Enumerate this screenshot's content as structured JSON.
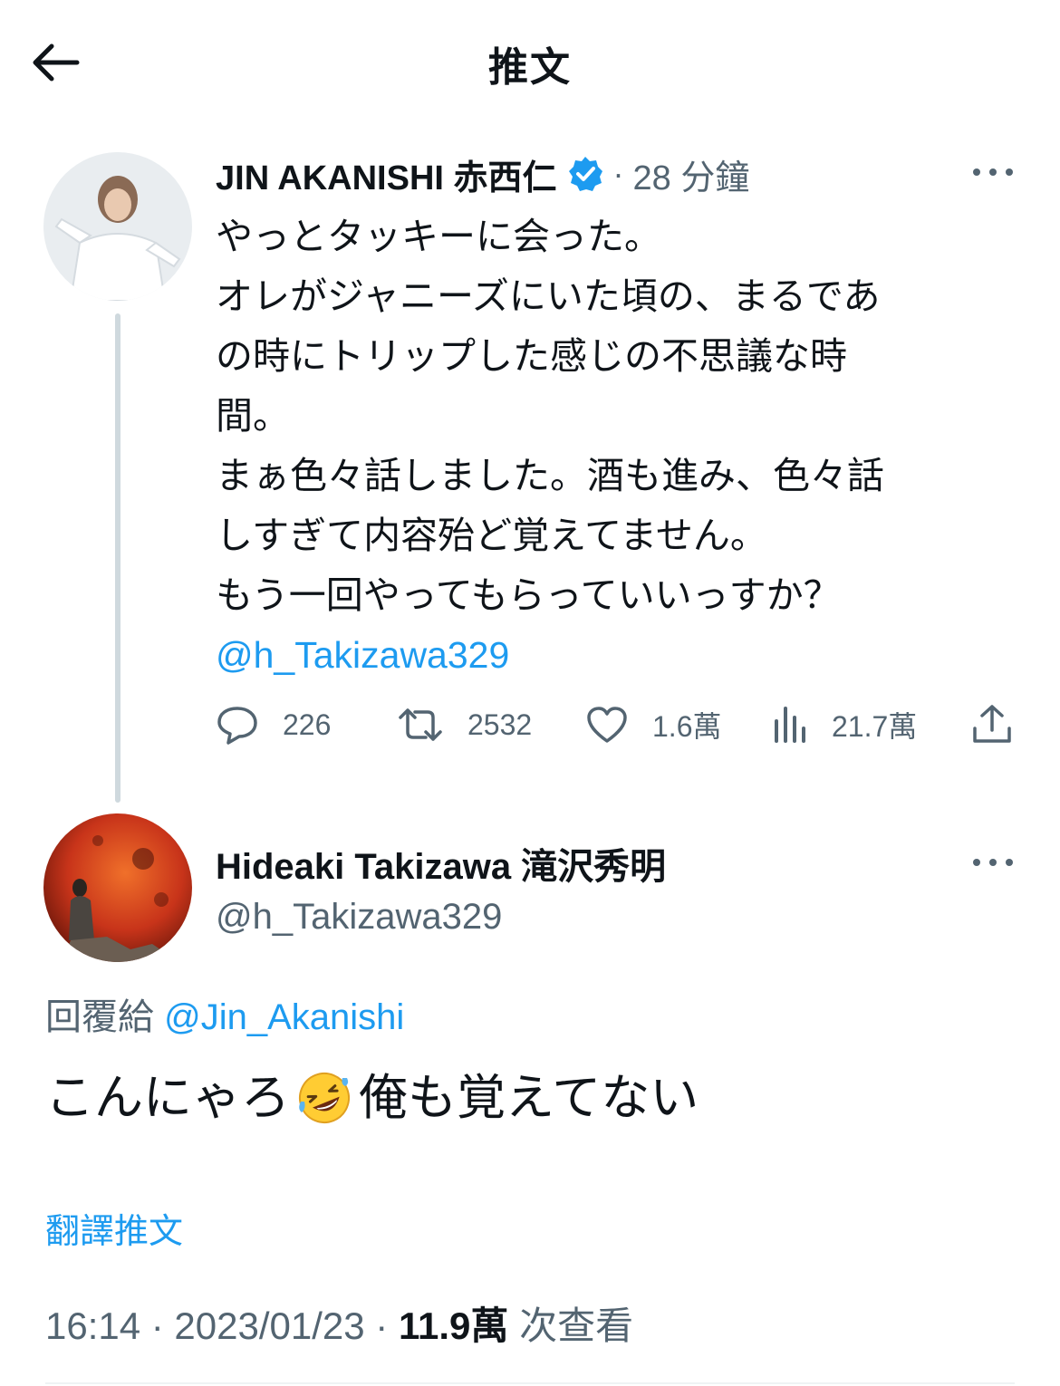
{
  "header": {
    "title": "推文",
    "back_icon": "arrow-left-icon"
  },
  "tweet": {
    "author_name": "JIN AKANISHI 赤西仁",
    "separator": "·",
    "time_ago": "28 分鐘",
    "lines": [
      "やっとタッキーに会った。",
      "オレがジャニーズにいた頃の、まるであ",
      "の時にトリップした感じの不思議な時",
      "間。",
      "まぁ色々話しました。酒も進み、色々話",
      "しすぎて内容殆ど覚えてません。",
      "もう一回やってもらっていいっすか？"
    ],
    "mention": "@h_Takizawa329",
    "actions": {
      "replies": "226",
      "retweets": "2532",
      "likes": "1.6萬",
      "views": "21.7萬"
    }
  },
  "reply": {
    "author_name": "Hideaki Takizawa 滝沢秀明",
    "handle": "@h_Takizawa329",
    "reply_to_label": "回覆給",
    "reply_to_handle": "@Jin_Akanishi",
    "text_before": "こんにゃろ",
    "text_after": "俺も覚えてない",
    "translate_label": "翻譯推文",
    "meta_time": "16:14 · 2023/01/23 · ",
    "meta_views": "11.9萬",
    "meta_views_label": " 次查看"
  },
  "colors": {
    "accent": "#1d9bf0",
    "text": "#0f1419",
    "secondary": "#536471",
    "thread_line": "#cfd9de"
  }
}
